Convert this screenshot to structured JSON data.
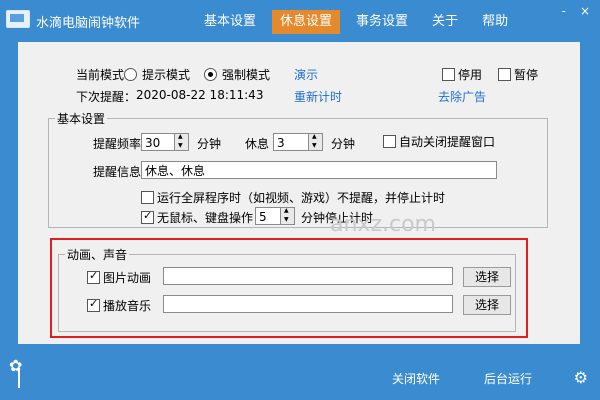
{
  "app": {
    "title": "水滴电脑闹钟软件"
  },
  "nav": {
    "items": [
      "基本设置",
      "休息设置",
      "事务设置",
      "关于",
      "帮助"
    ],
    "active_index": 1
  },
  "window_controls": {
    "minimize": "-",
    "close": "×"
  },
  "mode": {
    "current_label": "当前模式：",
    "options": [
      "提示模式",
      "强制模式"
    ],
    "selected": "强制模式",
    "demo_link": "演示",
    "stop_label": "停用",
    "pause_label": "暂停",
    "next_reminder_label": "下次提醒：",
    "next_reminder_time": "2020-08-22 18:11:43",
    "reset_link": "重新计时",
    "remove_ads_link": "去除广告"
  },
  "basic_settings": {
    "title": "基本设置",
    "reminder_freq_label": "提醒频率",
    "reminder_freq_value": "30",
    "minute_label_1": "分钟",
    "rest_label": "休息",
    "rest_value": "3",
    "minute_label_2": "分钟",
    "auto_close_label": "自动关闭提醒窗口",
    "auto_close_checked": false,
    "reminder_info_label": "提醒信息",
    "reminder_info_value": "休息、休息",
    "fullscreen_label": "运行全屏程序时（如视频、游戏）不提醒，并停止计时",
    "fullscreen_checked": false,
    "idle_label_prefix": "无鼠标、键盘操作",
    "idle_value": "5",
    "idle_label_suffix": "分钟停止计时",
    "idle_checked": true
  },
  "animation_sound": {
    "title": "动画、声音",
    "image_anim_label": "图片动画",
    "image_anim_checked": true,
    "image_anim_value": "",
    "select_label_1": "选择",
    "play_music_label": "播放音乐",
    "play_music_checked": true,
    "play_music_value": "",
    "select_label_2": "选择"
  },
  "footer": {
    "close_software": "关闭软件",
    "background_run": "后台运行"
  },
  "watermark": {
    "text": "anxz.com"
  },
  "colors": {
    "primary": "#3a8bd0",
    "accent": "#e58a2c",
    "link": "#1f6fd0",
    "highlight_border": "#e11d1d"
  }
}
